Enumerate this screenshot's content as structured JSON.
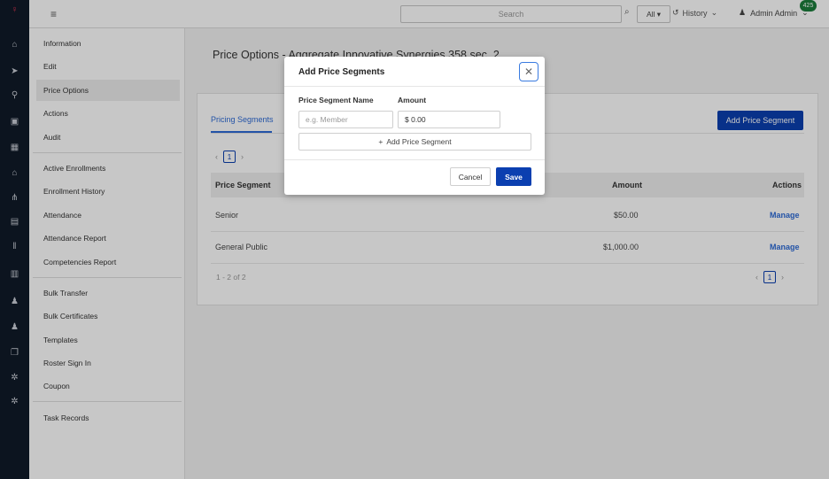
{
  "topbar": {
    "menu_icon": "hamburger-icon",
    "search_placeholder": "Search",
    "scope": "All",
    "history_label": "History",
    "user_label": "Admin Admin",
    "notification_count": "425"
  },
  "rail_icons": [
    "logo-icon",
    "home-icon",
    "send-icon",
    "user-icon",
    "video-icon",
    "calendar-icon",
    "graduation-icon",
    "org-icon",
    "save-icon",
    "library-icon",
    "report-icon",
    "person-icon",
    "person-icon",
    "copy-icon",
    "gear-icon",
    "gear-icon"
  ],
  "nav": {
    "group1": [
      "Information",
      "Edit",
      "Price Options",
      "Actions",
      "Audit"
    ],
    "group2": [
      "Active Enrollments",
      "Enrollment History",
      "Attendance",
      "Attendance Report",
      "Competencies Report"
    ],
    "group3": [
      "Bulk Transfer",
      "Bulk Certificates",
      "Templates",
      "Roster Sign In",
      "Coupon"
    ],
    "group4": [
      "Task Records"
    ],
    "active": "Price Options"
  },
  "page": {
    "title": "Price Options - Aggregate Innovative Synergies 358 sec. 2",
    "tab": "Pricing Segments",
    "add_button": "Add Price Segment",
    "page_number": "1",
    "columns": {
      "segment": "Price Segment",
      "amount": "Amount",
      "actions": "Actions"
    },
    "rows": [
      {
        "segment": "Senior",
        "amount": "$50.00",
        "action": "Manage"
      },
      {
        "segment": "General Public",
        "amount": "$1,000.00",
        "action": "Manage"
      }
    ],
    "count_text": "1 - 2 of 2"
  },
  "modal": {
    "title": "Add Price Segments",
    "name_label": "Price Segment Name",
    "amount_label": "Amount",
    "name_placeholder": "e.g. Member",
    "amount_value": "$ 0.00",
    "add_row_label": "Add Price Segment",
    "cancel_label": "Cancel",
    "save_label": "Save"
  },
  "colors": {
    "primary": "#0b3fb0",
    "link": "#2e6bd6",
    "rail": "#101a28",
    "badge": "#1c7d3b"
  }
}
